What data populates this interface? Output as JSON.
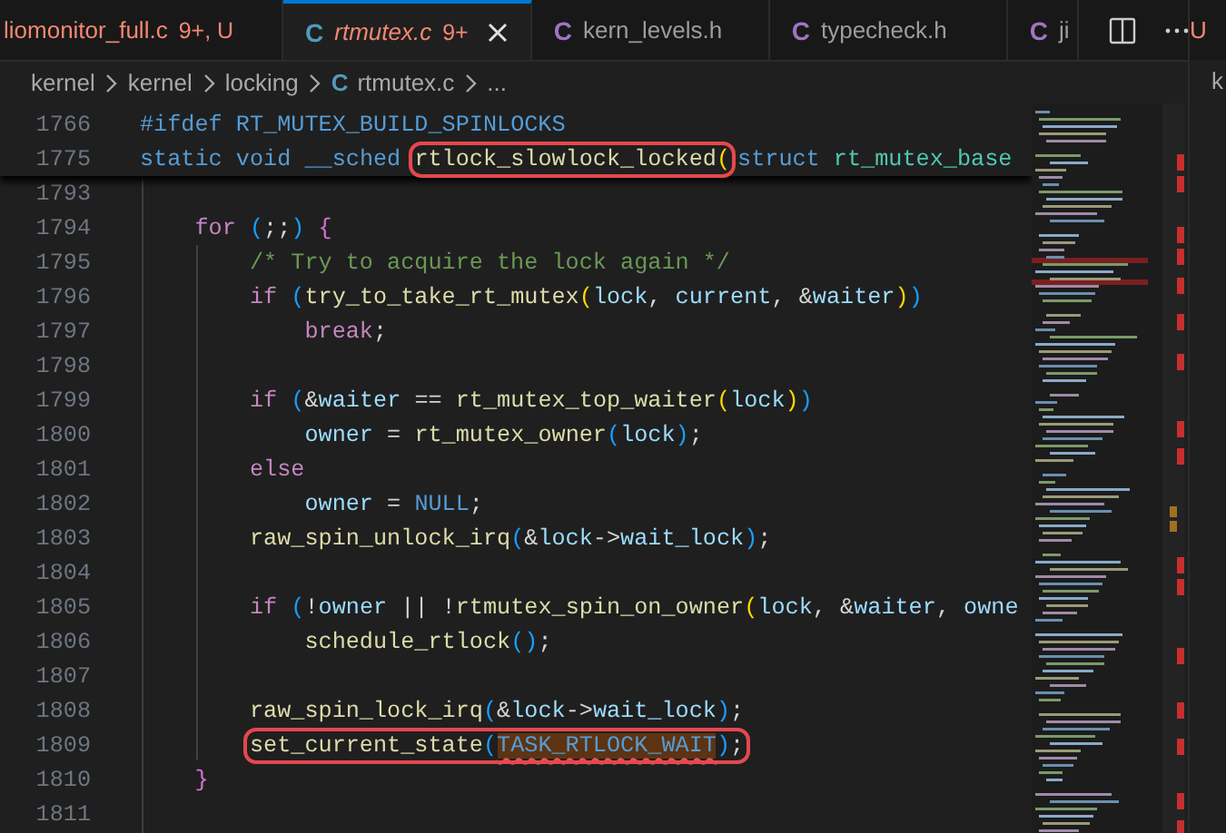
{
  "tabs": [
    {
      "label": "liomonitor_full.c",
      "badge": "9+, U",
      "problems": true,
      "preview": false,
      "selected": false
    },
    {
      "icon": "C",
      "color": "#519aba",
      "label": "rtmutex.c",
      "badge": "9+",
      "problems": true,
      "preview": true,
      "selected": true
    },
    {
      "icon": "C",
      "color": "#a074c4",
      "label": "kern_levels.h",
      "problems": false,
      "preview": false,
      "selected": false
    },
    {
      "icon": "C",
      "color": "#a074c4",
      "label": "typecheck.h",
      "problems": false,
      "preview": false,
      "selected": false
    },
    {
      "icon": "C",
      "color": "#a074c4",
      "label": "ji",
      "problems": false,
      "preview": false,
      "selected": false
    }
  ],
  "breadcrumb": [
    {
      "label": "kernel"
    },
    {
      "label": "kernel"
    },
    {
      "label": "locking"
    },
    {
      "icon": "C",
      "color": "#519aba",
      "label": "rtmutex.c"
    },
    {
      "label": "..."
    }
  ],
  "sticky_lines": [
    {
      "number": "1766",
      "parts": [
        {
          "text": "#ifdef",
          "kind": "kw"
        },
        {
          "text": " RT_MUTEX_BUILD_SPINLOCKS",
          "kind": "kw"
        }
      ]
    },
    {
      "number": "1775",
      "parts": [
        {
          "text": "static",
          "kind": "kw"
        },
        {
          "text": " void",
          "kind": "kw"
        },
        {
          "text": " __sched",
          "kind": "kw"
        },
        {
          "kind": "box",
          "parts": [
            {
              "text": " rtlock_slowlock_locked",
              "kind": "fn"
            },
            {
              "text": "(",
              "kind": "b1"
            }
          ]
        },
        {
          "text": "struct",
          "kind": "kw"
        },
        {
          "text": " rt_mutex_base",
          "kind": "type"
        }
      ]
    }
  ],
  "lines": [
    {
      "number": "1793"
    },
    {
      "number": "1794",
      "parts": [
        {
          "text": "    for",
          "kind": "ctl"
        },
        {
          "text": " (",
          "kind": "b3"
        },
        {
          "text": ";;",
          "kind": "p"
        },
        {
          "text": ")",
          "kind": "b3"
        },
        {
          "text": " {",
          "kind": "b2"
        }
      ]
    },
    {
      "number": "1795",
      "parts": [
        {
          "text": "        /* Try to acquire the lock again */",
          "kind": "comment"
        }
      ]
    },
    {
      "number": "1796",
      "parts": [
        {
          "text": "        if",
          "kind": "ctl"
        },
        {
          "text": " (",
          "kind": "b3"
        },
        {
          "text": "try_to_take_rt_mutex",
          "kind": "fn"
        },
        {
          "text": "(",
          "kind": "b1"
        },
        {
          "text": "lock",
          "kind": "var"
        },
        {
          "text": ",",
          "kind": "p"
        },
        {
          "text": " current",
          "kind": "var"
        },
        {
          "text": ", &",
          "kind": "p"
        },
        {
          "text": "waiter",
          "kind": "var"
        },
        {
          "text": ")",
          "kind": "b1"
        },
        {
          "text": ")",
          "kind": "b3"
        }
      ]
    },
    {
      "number": "1797",
      "parts": [
        {
          "text": "            break",
          "kind": "ctl"
        },
        {
          "text": ";",
          "kind": "p"
        }
      ]
    },
    {
      "number": "1798"
    },
    {
      "number": "1799",
      "parts": [
        {
          "text": "        if",
          "kind": "ctl"
        },
        {
          "text": " (",
          "kind": "b3"
        },
        {
          "text": "&",
          "kind": "p"
        },
        {
          "text": "waiter",
          "kind": "var"
        },
        {
          "text": " == ",
          "kind": "p"
        },
        {
          "text": "rt_mutex_top_waiter",
          "kind": "fn"
        },
        {
          "text": "(",
          "kind": "b1"
        },
        {
          "text": "lock",
          "kind": "var"
        },
        {
          "text": ")",
          "kind": "b1"
        },
        {
          "text": ")",
          "kind": "b3"
        }
      ]
    },
    {
      "number": "1800",
      "parts": [
        {
          "text": "            owner",
          "kind": "var"
        },
        {
          "text": " = ",
          "kind": "p"
        },
        {
          "text": "rt_mutex_owner",
          "kind": "fn"
        },
        {
          "text": "(",
          "kind": "b3"
        },
        {
          "text": "lock",
          "kind": "var"
        },
        {
          "text": ")",
          "kind": "b3"
        },
        {
          "text": ";",
          "kind": "p"
        }
      ]
    },
    {
      "number": "1801",
      "parts": [
        {
          "text": "        else",
          "kind": "ctl"
        }
      ]
    },
    {
      "number": "1802",
      "parts": [
        {
          "text": "            owner",
          "kind": "var"
        },
        {
          "text": " = ",
          "kind": "p"
        },
        {
          "text": "NULL",
          "kind": "kw"
        },
        {
          "text": ";",
          "kind": "p"
        }
      ]
    },
    {
      "number": "1803",
      "parts": [
        {
          "text": "        raw_spin_unlock_irq",
          "kind": "fn"
        },
        {
          "text": "(",
          "kind": "b3"
        },
        {
          "text": "&",
          "kind": "p"
        },
        {
          "text": "lock",
          "kind": "var"
        },
        {
          "text": "->",
          "kind": "p"
        },
        {
          "text": "wait_lock",
          "kind": "var"
        },
        {
          "text": ")",
          "kind": "b3"
        },
        {
          "text": ";",
          "kind": "p"
        }
      ]
    },
    {
      "number": "1804"
    },
    {
      "number": "1805",
      "parts": [
        {
          "text": "        if",
          "kind": "ctl"
        },
        {
          "text": " (",
          "kind": "b3"
        },
        {
          "text": "!",
          "kind": "p"
        },
        {
          "text": "owner",
          "kind": "var"
        },
        {
          "text": " || !",
          "kind": "p"
        },
        {
          "text": "rtmutex_spin_on_owner",
          "kind": "fn"
        },
        {
          "text": "(",
          "kind": "b1"
        },
        {
          "text": "lock",
          "kind": "var"
        },
        {
          "text": ", &",
          "kind": "p"
        },
        {
          "text": "waiter",
          "kind": "var"
        },
        {
          "text": ",",
          "kind": "p"
        },
        {
          "text": " owne",
          "kind": "var"
        }
      ]
    },
    {
      "number": "1806",
      "parts": [
        {
          "text": "            schedule_rtlock",
          "kind": "fn"
        },
        {
          "text": "(",
          "kind": "b3"
        },
        {
          "text": ")",
          "kind": "b3"
        },
        {
          "text": ";",
          "kind": "p"
        }
      ]
    },
    {
      "number": "1807"
    },
    {
      "number": "1808",
      "parts": [
        {
          "text": "        raw_spin_lock_irq",
          "kind": "fn"
        },
        {
          "text": "(",
          "kind": "b3"
        },
        {
          "text": "&",
          "kind": "p"
        },
        {
          "text": "lock",
          "kind": "var"
        },
        {
          "text": "->",
          "kind": "p"
        },
        {
          "text": "wait_lock",
          "kind": "var"
        },
        {
          "text": ")",
          "kind": "b3"
        },
        {
          "text": ";",
          "kind": "p"
        }
      ]
    },
    {
      "number": "1809",
      "parts": [
        {
          "kind": "box",
          "parts": [
            {
              "text": "        set_current_state",
              "kind": "fn"
            },
            {
              "text": "(",
              "kind": "b3"
            },
            {
              "text": "TASK_RTLOCK_WAIT",
              "kind": "error"
            },
            {
              "text": ")",
              "kind": "b3"
            },
            {
              "text": ";",
              "kind": "p"
            }
          ]
        }
      ]
    },
    {
      "number": "1810",
      "parts": [
        {
          "text": "    }",
          "kind": "b2"
        }
      ]
    },
    {
      "number": "1811"
    }
  ],
  "second_pane": {
    "tab_text": "U",
    "breadcrumb_text": "k"
  }
}
